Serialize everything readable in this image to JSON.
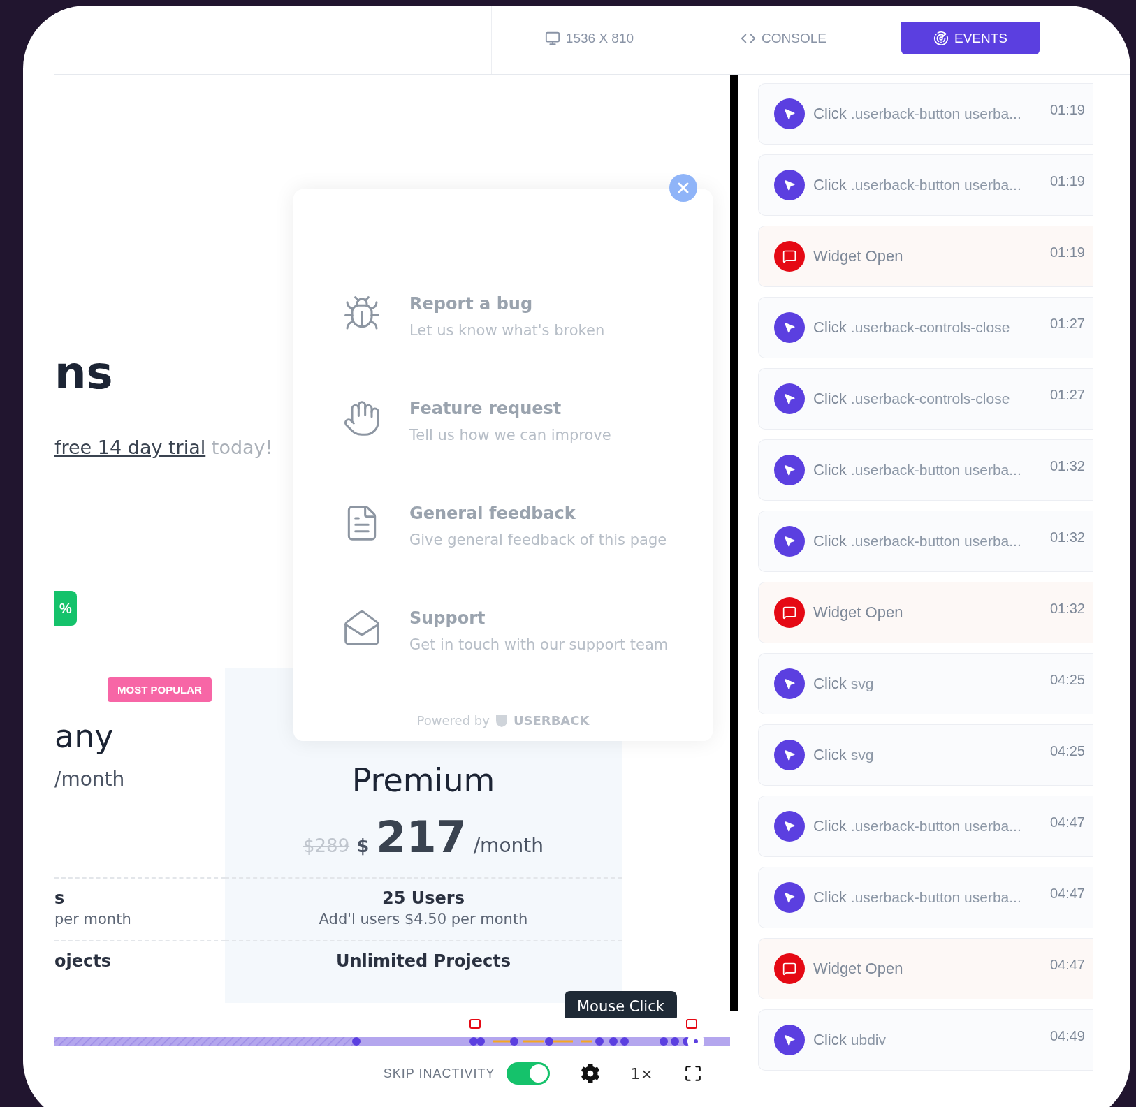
{
  "toolbar": {
    "tabs": [
      {
        "kind": "resolution",
        "label": "1536 X 810",
        "selected": false
      },
      {
        "kind": "console",
        "label": "CONSOLE",
        "selected": false
      },
      {
        "kind": "events",
        "label": "EVENTS",
        "selected": true
      }
    ]
  },
  "page": {
    "heading": "ns",
    "trial": {
      "link": "free 14 day trial",
      "rest": " today!"
    },
    "discount_badge": "%",
    "pricing": {
      "badge": "MOST POPULAR",
      "plans": [
        {
          "name": "any",
          "per": "/month",
          "users": "s",
          "users_note": "per month",
          "projects": "ojects"
        },
        {
          "name": "Premium",
          "old_price": "$289",
          "currency": "$",
          "price": "217",
          "per": "/month",
          "users": "25 Users",
          "users_note": "Add'l users $4.50 per month",
          "projects": "Unlimited Projects"
        }
      ]
    }
  },
  "widget": {
    "items": [
      {
        "kind": "bug",
        "title": "Report a bug",
        "description": "Let us know what's broken"
      },
      {
        "kind": "feature",
        "title": "Feature request",
        "description": "Tell us how we can improve"
      },
      {
        "kind": "feedback",
        "title": "General feedback",
        "description": "Give general feedback of this page"
      },
      {
        "kind": "support",
        "title": "Support",
        "description": "Get in touch with our support team"
      }
    ],
    "powered_by": "Powered by",
    "brand": "USERBACK"
  },
  "player": {
    "tooltip": "Mouse Click",
    "skip_inactivity": {
      "label": "SKIP INACTIVITY",
      "on": true
    },
    "speed": "1×"
  },
  "events": [
    {
      "kind": "click",
      "action": "Click",
      "target": ".userback-button userba...",
      "time": "01:19"
    },
    {
      "kind": "click",
      "action": "Click",
      "target": ".userback-button userba...",
      "time": "01:19"
    },
    {
      "kind": "widget",
      "action": "Widget Open",
      "time": "01:19"
    },
    {
      "kind": "click",
      "action": "Click",
      "target": ".userback-controls-close",
      "time": "01:27"
    },
    {
      "kind": "click",
      "action": "Click",
      "target": ".userback-controls-close",
      "time": "01:27"
    },
    {
      "kind": "click",
      "action": "Click",
      "target": ".userback-button userba...",
      "time": "01:32"
    },
    {
      "kind": "click",
      "action": "Click",
      "target": ".userback-button userba...",
      "time": "01:32"
    },
    {
      "kind": "widget",
      "action": "Widget Open",
      "time": "01:32"
    },
    {
      "kind": "click",
      "action": "Click",
      "target": "svg",
      "time": "04:25"
    },
    {
      "kind": "click",
      "action": "Click",
      "target": "svg",
      "time": "04:25"
    },
    {
      "kind": "click",
      "action": "Click",
      "target": ".userback-button userba...",
      "time": "04:47"
    },
    {
      "kind": "click",
      "action": "Click",
      "target": ".userback-button userba...",
      "time": "04:47"
    },
    {
      "kind": "widget",
      "action": "Widget Open",
      "time": "04:47"
    },
    {
      "kind": "click",
      "action": "Click",
      "target": "ubdiv",
      "time": "04:49"
    }
  ]
}
